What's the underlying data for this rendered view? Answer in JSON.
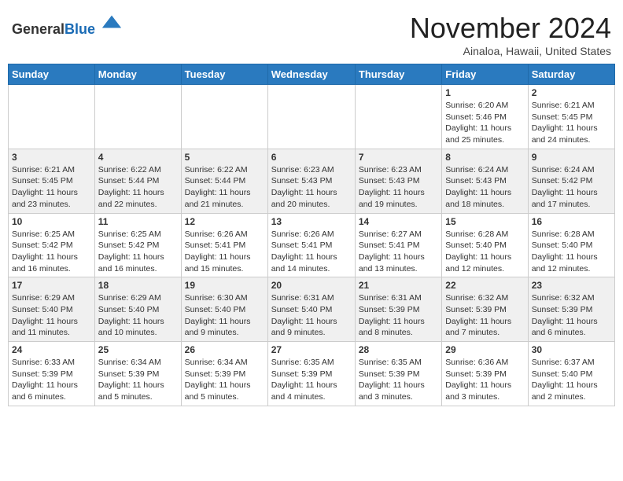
{
  "header": {
    "logo_general": "General",
    "logo_blue": "Blue",
    "month": "November 2024",
    "location": "Ainaloa, Hawaii, United States"
  },
  "days_of_week": [
    "Sunday",
    "Monday",
    "Tuesday",
    "Wednesday",
    "Thursday",
    "Friday",
    "Saturday"
  ],
  "weeks": [
    {
      "days": [
        {
          "num": "",
          "info": ""
        },
        {
          "num": "",
          "info": ""
        },
        {
          "num": "",
          "info": ""
        },
        {
          "num": "",
          "info": ""
        },
        {
          "num": "",
          "info": ""
        },
        {
          "num": "1",
          "info": "Sunrise: 6:20 AM\nSunset: 5:46 PM\nDaylight: 11 hours and 25 minutes."
        },
        {
          "num": "2",
          "info": "Sunrise: 6:21 AM\nSunset: 5:45 PM\nDaylight: 11 hours and 24 minutes."
        }
      ]
    },
    {
      "days": [
        {
          "num": "3",
          "info": "Sunrise: 6:21 AM\nSunset: 5:45 PM\nDaylight: 11 hours and 23 minutes."
        },
        {
          "num": "4",
          "info": "Sunrise: 6:22 AM\nSunset: 5:44 PM\nDaylight: 11 hours and 22 minutes."
        },
        {
          "num": "5",
          "info": "Sunrise: 6:22 AM\nSunset: 5:44 PM\nDaylight: 11 hours and 21 minutes."
        },
        {
          "num": "6",
          "info": "Sunrise: 6:23 AM\nSunset: 5:43 PM\nDaylight: 11 hours and 20 minutes."
        },
        {
          "num": "7",
          "info": "Sunrise: 6:23 AM\nSunset: 5:43 PM\nDaylight: 11 hours and 19 minutes."
        },
        {
          "num": "8",
          "info": "Sunrise: 6:24 AM\nSunset: 5:43 PM\nDaylight: 11 hours and 18 minutes."
        },
        {
          "num": "9",
          "info": "Sunrise: 6:24 AM\nSunset: 5:42 PM\nDaylight: 11 hours and 17 minutes."
        }
      ]
    },
    {
      "days": [
        {
          "num": "10",
          "info": "Sunrise: 6:25 AM\nSunset: 5:42 PM\nDaylight: 11 hours and 16 minutes."
        },
        {
          "num": "11",
          "info": "Sunrise: 6:25 AM\nSunset: 5:42 PM\nDaylight: 11 hours and 16 minutes."
        },
        {
          "num": "12",
          "info": "Sunrise: 6:26 AM\nSunset: 5:41 PM\nDaylight: 11 hours and 15 minutes."
        },
        {
          "num": "13",
          "info": "Sunrise: 6:26 AM\nSunset: 5:41 PM\nDaylight: 11 hours and 14 minutes."
        },
        {
          "num": "14",
          "info": "Sunrise: 6:27 AM\nSunset: 5:41 PM\nDaylight: 11 hours and 13 minutes."
        },
        {
          "num": "15",
          "info": "Sunrise: 6:28 AM\nSunset: 5:40 PM\nDaylight: 11 hours and 12 minutes."
        },
        {
          "num": "16",
          "info": "Sunrise: 6:28 AM\nSunset: 5:40 PM\nDaylight: 11 hours and 12 minutes."
        }
      ]
    },
    {
      "days": [
        {
          "num": "17",
          "info": "Sunrise: 6:29 AM\nSunset: 5:40 PM\nDaylight: 11 hours and 11 minutes."
        },
        {
          "num": "18",
          "info": "Sunrise: 6:29 AM\nSunset: 5:40 PM\nDaylight: 11 hours and 10 minutes."
        },
        {
          "num": "19",
          "info": "Sunrise: 6:30 AM\nSunset: 5:40 PM\nDaylight: 11 hours and 9 minutes."
        },
        {
          "num": "20",
          "info": "Sunrise: 6:31 AM\nSunset: 5:40 PM\nDaylight: 11 hours and 9 minutes."
        },
        {
          "num": "21",
          "info": "Sunrise: 6:31 AM\nSunset: 5:39 PM\nDaylight: 11 hours and 8 minutes."
        },
        {
          "num": "22",
          "info": "Sunrise: 6:32 AM\nSunset: 5:39 PM\nDaylight: 11 hours and 7 minutes."
        },
        {
          "num": "23",
          "info": "Sunrise: 6:32 AM\nSunset: 5:39 PM\nDaylight: 11 hours and 6 minutes."
        }
      ]
    },
    {
      "days": [
        {
          "num": "24",
          "info": "Sunrise: 6:33 AM\nSunset: 5:39 PM\nDaylight: 11 hours and 6 minutes."
        },
        {
          "num": "25",
          "info": "Sunrise: 6:34 AM\nSunset: 5:39 PM\nDaylight: 11 hours and 5 minutes."
        },
        {
          "num": "26",
          "info": "Sunrise: 6:34 AM\nSunset: 5:39 PM\nDaylight: 11 hours and 5 minutes."
        },
        {
          "num": "27",
          "info": "Sunrise: 6:35 AM\nSunset: 5:39 PM\nDaylight: 11 hours and 4 minutes."
        },
        {
          "num": "28",
          "info": "Sunrise: 6:35 AM\nSunset: 5:39 PM\nDaylight: 11 hours and 3 minutes."
        },
        {
          "num": "29",
          "info": "Sunrise: 6:36 AM\nSunset: 5:39 PM\nDaylight: 11 hours and 3 minutes."
        },
        {
          "num": "30",
          "info": "Sunrise: 6:37 AM\nSunset: 5:40 PM\nDaylight: 11 hours and 2 minutes."
        }
      ]
    }
  ]
}
